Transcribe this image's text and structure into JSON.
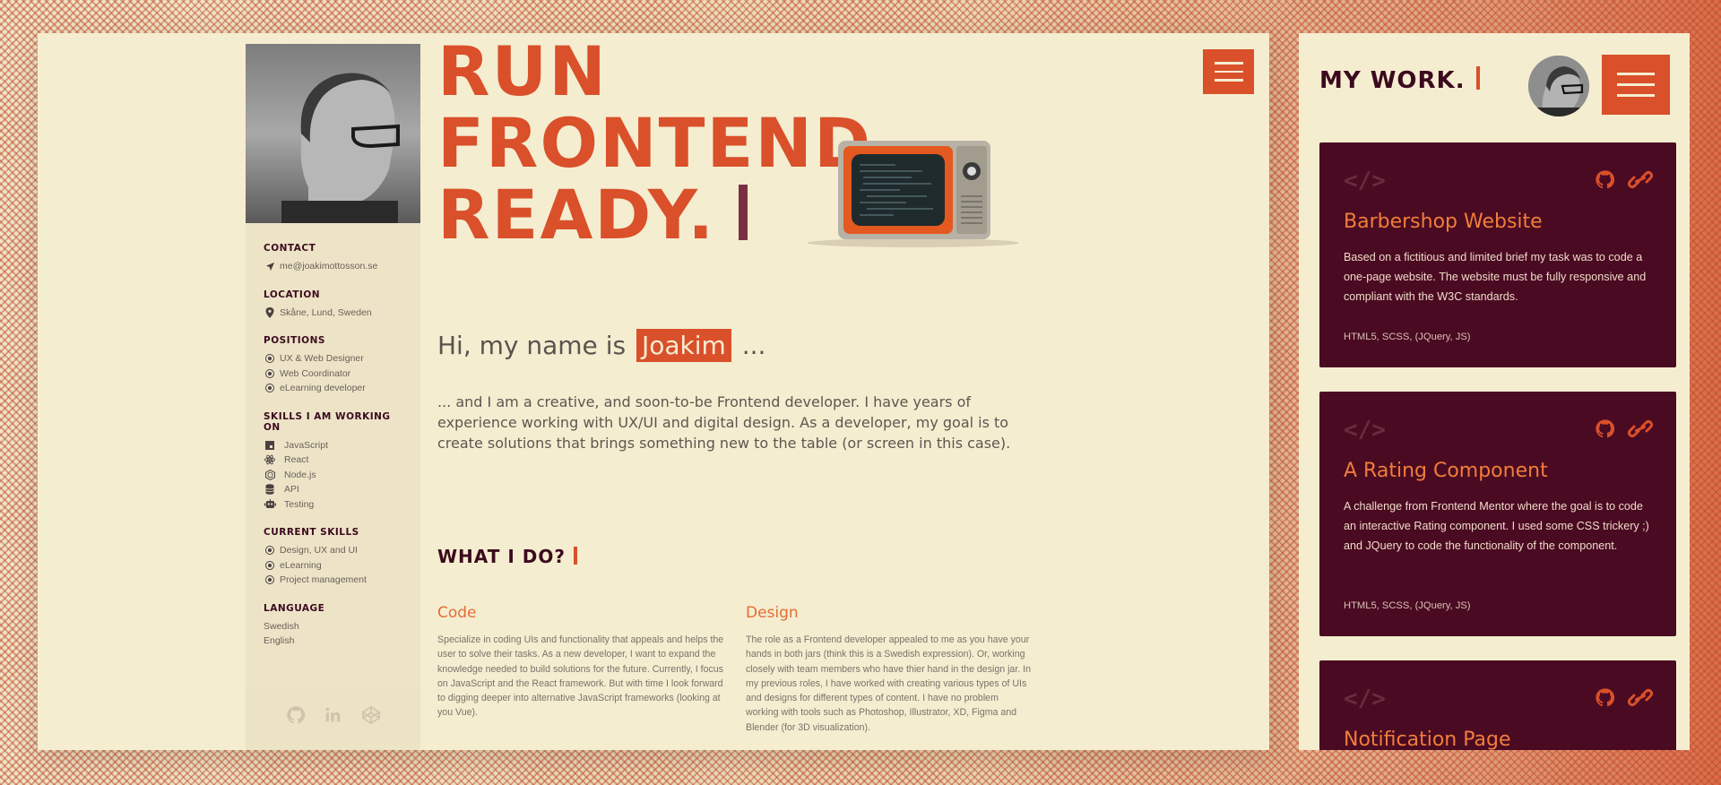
{
  "hero": {
    "title_lines": [
      "RUN",
      "FRONTEND",
      "READY."
    ],
    "menu_icon": "hamburger-icon"
  },
  "sidebar": {
    "contact": {
      "title": "CONTACT",
      "email": "me@joakimottosson.se",
      "icon": "paper-plane-icon"
    },
    "location": {
      "title": "LOCATION",
      "value": "Skåne, Lund, Sweden",
      "icon": "map-pin-icon"
    },
    "positions": {
      "title": "POSITIONS",
      "items": [
        "UX & Web Designer",
        "Web Coordinator",
        "eLearning developer"
      ]
    },
    "skills_working": {
      "title": "SKILLS I AM WORKING ON",
      "items": [
        {
          "label": "JavaScript",
          "icon": "javascript-icon"
        },
        {
          "label": "React",
          "icon": "react-icon"
        },
        {
          "label": "Node.js",
          "icon": "nodejs-icon"
        },
        {
          "label": "API",
          "icon": "database-icon"
        },
        {
          "label": "Testing",
          "icon": "robot-icon"
        }
      ]
    },
    "current_skills": {
      "title": "CURRENT SKILLS",
      "items": [
        "Design, UX and UI",
        "eLearning",
        "Project management"
      ]
    },
    "language": {
      "title": "LANGUAGE",
      "items": [
        "Swedish",
        "English"
      ]
    },
    "social": [
      "github-icon",
      "linkedin-icon",
      "codepen-icon"
    ]
  },
  "greeting": {
    "prefix": "Hi, my name is",
    "name": "Joakim",
    "suffix": "..."
  },
  "intro": "... and I am a creative, and soon-to-be Frontend developer. I have years of experience working with UX/UI and digital design. As a developer, my goal is to create solutions that brings something new to the table (or screen in this case).",
  "what_i_do": {
    "title": "WHAT I DO?",
    "code": {
      "heading": "Code",
      "text": "Specialize in coding UIs and functionality that appeals and helps the user to solve their tasks. As a new developer, I want to expand the knowledge needed to build solutions for the future. Currently, I focus on JavaScript and the React framework. But with time I look forward to digging deeper into alternative JavaScript frameworks (looking at you Vue)."
    },
    "design": {
      "heading": "Design",
      "text": "The role as a Frontend developer appealed to me as you have your hands in both jars (think this is a Swedish expression). Or, working closely with team members who have thier hand in the design jar. In my previous roles, I have worked with creating various types of UIs and designs for different types of content. I have no problem working with tools such as Photoshop, Illustrator, XD, Figma and Blender (for 3D visualization)."
    }
  },
  "work": {
    "title": "MY WORK.",
    "cards": [
      {
        "title": "Barbershop Website",
        "description": "Based on a fictitious and limited brief my task was to code a one-page website. The website must be fully responsive and compliant with the W3C standards.",
        "tech": "HTML5, SCSS, (JQuery, JS)"
      },
      {
        "title": "A Rating Component",
        "description": "A challenge from Frontend Mentor where the goal is to code an interactive Rating component. I used some CSS trickery ;) and JQuery to code the functionality of the component.",
        "tech": "HTML5, SCSS, (JQuery, JS)"
      },
      {
        "title": "Notification Page",
        "description": "",
        "tech": ""
      }
    ]
  },
  "colors": {
    "accent": "#d9502a",
    "dark_maroon": "#4a0a22",
    "cream": "#f5edd0",
    "orange_text": "#e46d35"
  }
}
